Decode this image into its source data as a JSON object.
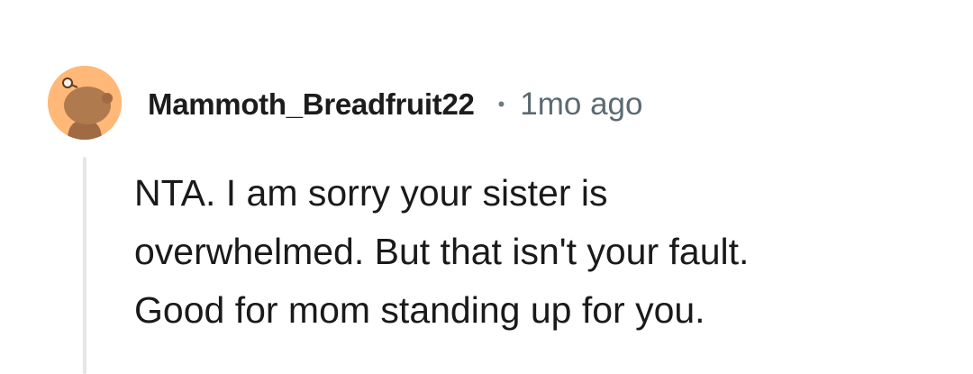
{
  "comment": {
    "avatar_icon": "reddit-snoo-avatar-icon",
    "avatar_bg": "#ffb878",
    "username": "Mammoth_Breadfruit22",
    "separator": "•",
    "timestamp": "1mo ago",
    "body_lines": [
      "NTA. I am sorry your sister is",
      "overwhelmed. But that isn't your fault.",
      "Good for mom standing up for you."
    ]
  }
}
